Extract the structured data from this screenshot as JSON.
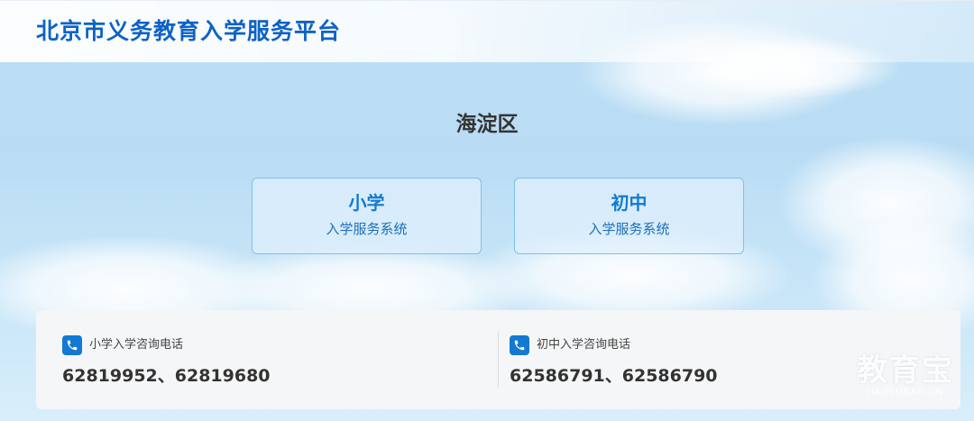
{
  "header": {
    "site_title": "北京市义务教育入学服务平台"
  },
  "main": {
    "district": "海淀区",
    "cards": [
      {
        "title": "小学",
        "subtitle": "入学服务系统"
      },
      {
        "title": "初中",
        "subtitle": "入学服务系统"
      }
    ]
  },
  "contacts": [
    {
      "icon": "phone-icon",
      "label": "小学入学咨询电话",
      "numbers": "62819952、62819680"
    },
    {
      "icon": "phone-icon",
      "label": "初中入学咨询电话",
      "numbers": "62586791、62586790"
    }
  ],
  "watermark": {
    "main": "教育宝",
    "sub": "JIAOYUBAO.CN"
  },
  "colors": {
    "accent": "#1479d2",
    "title": "#0d62c7"
  }
}
